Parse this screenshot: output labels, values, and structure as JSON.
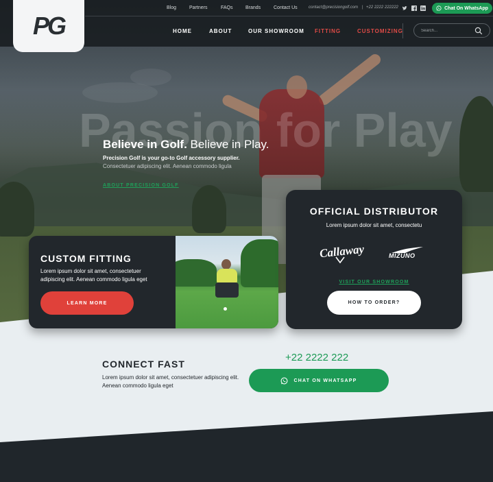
{
  "brand": {
    "logo_text": "PG"
  },
  "topbar": {
    "links": [
      "Blog",
      "Partners",
      "FAQs",
      "Brands",
      "Contact Us"
    ],
    "email": "contact@precisiongolf.com",
    "separator": "|",
    "phone": "+22 2222 222222",
    "social_icons": [
      "twitter-icon",
      "facebook-icon",
      "linkedin-icon"
    ],
    "whatsapp_label": "Chat On WhatsApp"
  },
  "nav": {
    "items": [
      {
        "label": "HOME",
        "active": false
      },
      {
        "label": "ABOUT",
        "active": false
      },
      {
        "label": "OUR SHOWROOM",
        "active": false
      },
      {
        "label": "FITTING",
        "active": true
      },
      {
        "label": "CUSTOMIZING",
        "active": true
      }
    ],
    "search_placeholder": "Search..."
  },
  "hero": {
    "watermark": "Passion for Play",
    "title_bold": "Believe in Golf.",
    "title_rest": " Believe in Play.",
    "subtitle_bold": "Precision Golf is your go-to Golf accessory supplier.",
    "subtitle": "Consectetuer adipiscing elit. Aenean commodo ligula",
    "link": "ABOUT PRECISION GOLF"
  },
  "fitting_card": {
    "title": "CUSTOM FITTING",
    "text": "Lorem ipsum dolor sit amet, consectetuer adipiscing elit. Aenean commodo ligula eget",
    "button": "LEARN MORE"
  },
  "distributor_card": {
    "title": "OFFICIAL DISTRIBUTOR",
    "subtitle": "Lorem ipsum dolor sit amet, consectetu",
    "brands": [
      "Callaway",
      "MIZUNO"
    ],
    "link": "VISIT OUR SHOWROOM",
    "button": "HOW TO ORDER?"
  },
  "connect": {
    "title": "CONNECT FAST",
    "text": "Lorem ipsum dolor sit amet, consectetuer adipiscing elit. Aenean commodo ligula eget",
    "phone": "+22 2222 222",
    "whatsapp_button": "CHAT ON WHATSAPP"
  },
  "colors": {
    "dark": "#22272c",
    "accent_red": "#e0413a",
    "accent_green": "#1c9a55",
    "light_bg": "#e9eef1"
  }
}
